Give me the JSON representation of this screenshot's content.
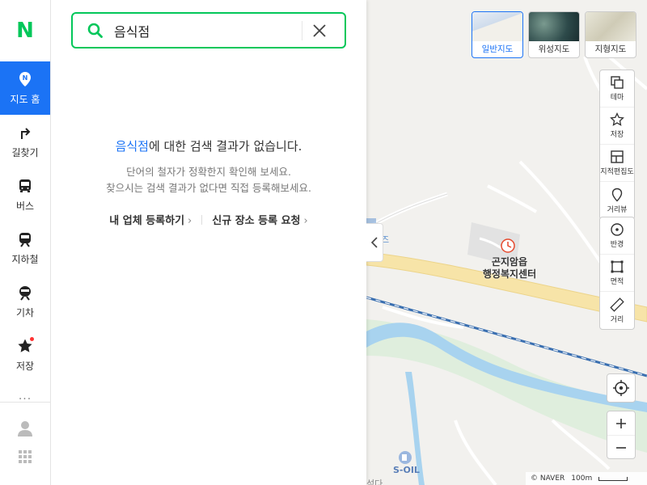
{
  "logo": "N",
  "nav": {
    "items": [
      {
        "label": "지도 홈",
        "icon": "map-home-icon"
      },
      {
        "label": "길찾기",
        "icon": "directions-icon"
      },
      {
        "label": "버스",
        "icon": "bus-icon"
      },
      {
        "label": "지하철",
        "icon": "subway-icon"
      },
      {
        "label": "기차",
        "icon": "train-icon"
      },
      {
        "label": "저장",
        "icon": "star-icon"
      }
    ],
    "more": "···"
  },
  "search": {
    "value": "음식점"
  },
  "empty": {
    "keyword": "음식점",
    "title_suffix": "에 대한 검색 결과가 없습니다.",
    "line1": "단어의 철자가 정확한지 확인해 보세요.",
    "line2": "찾으시는 검색 결과가 없다면 직접 등록해보세요."
  },
  "links": {
    "register_business": "내 업체 등록하기",
    "request_new_place": "신규 장소 등록 요청"
  },
  "map_types": [
    {
      "label": "일반지도",
      "active": true
    },
    {
      "label": "위성지도",
      "active": false
    },
    {
      "label": "지형지도",
      "active": false
    }
  ],
  "tools_group1": [
    {
      "label": "테마"
    },
    {
      "label": "저장"
    },
    {
      "label": "지적편집도"
    },
    {
      "label": "거리뷰"
    }
  ],
  "tools_group2": [
    {
      "label": "반경"
    },
    {
      "label": "면적"
    },
    {
      "label": "거리"
    }
  ],
  "map": {
    "poi_name_line1": "곤지암읍",
    "poi_name_line2": "행정복지센터",
    "gas_station": "S-OIL",
    "partial_label": "즈",
    "bottom_label": "석다"
  },
  "footer": {
    "copyright": "© NAVER",
    "scale": "100m"
  },
  "colors": {
    "naver_green": "#03c75a",
    "accent_blue": "#1b73f5"
  }
}
